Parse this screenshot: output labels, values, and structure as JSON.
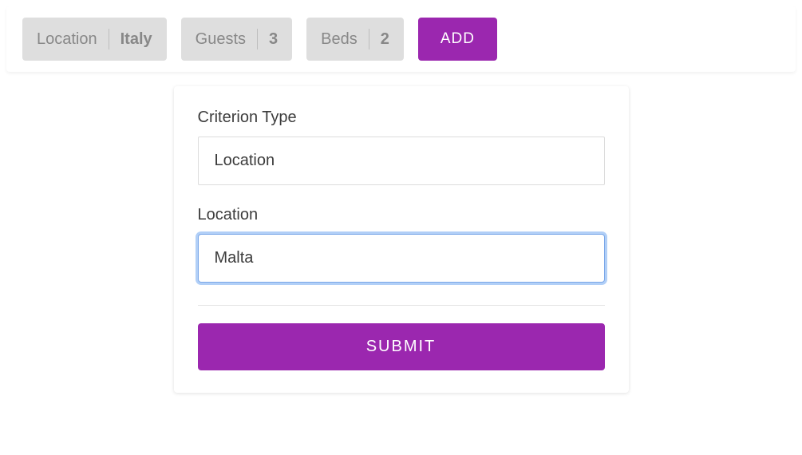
{
  "topbar": {
    "chips": [
      {
        "label": "Location",
        "value": "Italy"
      },
      {
        "label": "Guests",
        "value": "3"
      },
      {
        "label": "Beds",
        "value": "2"
      }
    ],
    "add_label": "ADD"
  },
  "panel": {
    "criterion_type_label": "Criterion Type",
    "criterion_type_value": "Location",
    "location_label": "Location",
    "location_value": "Malta",
    "submit_label": "SUBMIT"
  },
  "colors": {
    "accent": "#9b27af",
    "chip_bg": "#dedede"
  }
}
